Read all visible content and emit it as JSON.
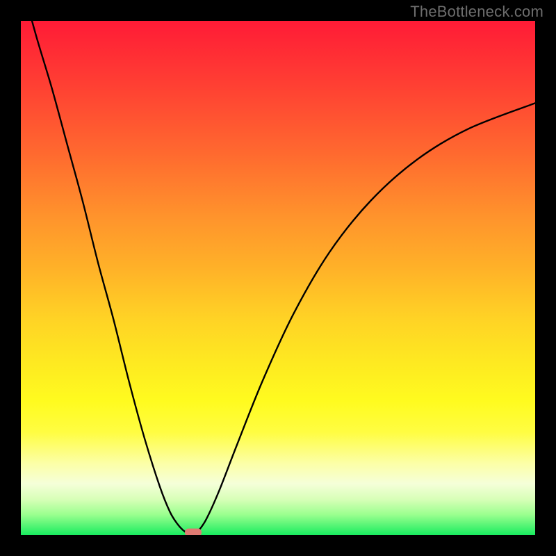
{
  "watermark": "TheBottleneck.com",
  "colors": {
    "page_bg": "#000000",
    "curve_stroke": "#000000",
    "marker_fill": "#df7a72",
    "watermark_text": "#6d6d6d"
  },
  "chart_data": {
    "type": "line",
    "title": "",
    "xlabel": "",
    "ylabel": "",
    "xlim": [
      0,
      1
    ],
    "ylim": [
      0,
      1
    ],
    "x_minimum": 0.33,
    "series": [
      {
        "name": "bottleneck-curve",
        "x": [
          0.0,
          0.03,
          0.06,
          0.09,
          0.12,
          0.15,
          0.18,
          0.21,
          0.24,
          0.27,
          0.29,
          0.305,
          0.315,
          0.325,
          0.333,
          0.343,
          0.36,
          0.385,
          0.42,
          0.47,
          0.53,
          0.6,
          0.68,
          0.77,
          0.87,
          1.0
        ],
        "y": [
          1.08,
          0.97,
          0.87,
          0.76,
          0.65,
          0.53,
          0.42,
          0.3,
          0.19,
          0.095,
          0.045,
          0.021,
          0.01,
          0.003,
          0.0,
          0.006,
          0.03,
          0.085,
          0.175,
          0.3,
          0.43,
          0.55,
          0.65,
          0.73,
          0.79,
          0.84
        ]
      }
    ],
    "marker": {
      "x": 0.335,
      "y": 0.0
    },
    "background_gradient_stops": [
      {
        "pos": 0.0,
        "color": "#ff1b36"
      },
      {
        "pos": 0.12,
        "color": "#ff3e33"
      },
      {
        "pos": 0.26,
        "color": "#ff6a2f"
      },
      {
        "pos": 0.38,
        "color": "#ff932c"
      },
      {
        "pos": 0.48,
        "color": "#ffb128"
      },
      {
        "pos": 0.58,
        "color": "#ffd325"
      },
      {
        "pos": 0.66,
        "color": "#fee821"
      },
      {
        "pos": 0.74,
        "color": "#fffb1f"
      },
      {
        "pos": 0.8,
        "color": "#fffd42"
      },
      {
        "pos": 0.86,
        "color": "#fcffa6"
      },
      {
        "pos": 0.9,
        "color": "#f5ffd9"
      },
      {
        "pos": 0.93,
        "color": "#d8ffb8"
      },
      {
        "pos": 0.96,
        "color": "#9bff8f"
      },
      {
        "pos": 1.0,
        "color": "#18ec5f"
      }
    ]
  }
}
